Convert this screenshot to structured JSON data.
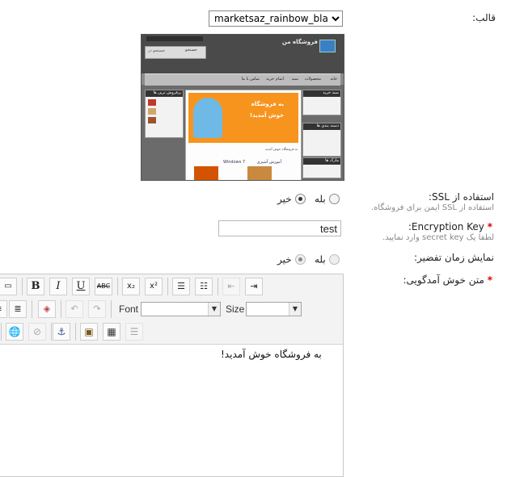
{
  "theme": {
    "label": "قالب:",
    "value": "marketsaz_rainbow_black"
  },
  "preview": {
    "site_title": "فروشگاه من",
    "search_button": "جستجو",
    "search_placeholder": "جستجو در",
    "nav": [
      "خانه",
      "محصولات",
      "سبد",
      "اتمام خرید",
      "تماس با ما"
    ],
    "banner_line1": "به فروشگاه",
    "banner_line2": "خوش آمدید!",
    "welcome": "به فروشگاه خوش آمدید",
    "cart_box": "سبد خرید",
    "bestsellers": "پرفروش ترین ها",
    "categories": "دسته بندی ها",
    "brands": "مارک ها",
    "product_windows": "Windows 7",
    "product_learn": "آموزش آشپزی",
    "colors": {
      "banner": "#f7941d",
      "frame": "#6b6b6b",
      "body": "#e9e9e9"
    }
  },
  "ssl": {
    "label": "استفاده از SSL:",
    "help": "استفاده از SSL ایمن برای فروشگاه.",
    "yes": "بله",
    "no": "خیر",
    "selected": "no"
  },
  "encryption": {
    "required_mark": "*",
    "label": "Encryption Key:",
    "help": "لطفا یک secret key وارد نمایید.",
    "value": "test"
  },
  "thumb_time": {
    "label": "نمایش زمان تفضیر:",
    "yes": "بله",
    "no": "خیر",
    "selected": "no",
    "disabled": true
  },
  "welcome_text": {
    "required_mark": "*",
    "label": "متن خوش آمدگویی:",
    "font_label": "Font",
    "size_label": "Size",
    "content": "به فروشگاه خوش آمدید!"
  }
}
